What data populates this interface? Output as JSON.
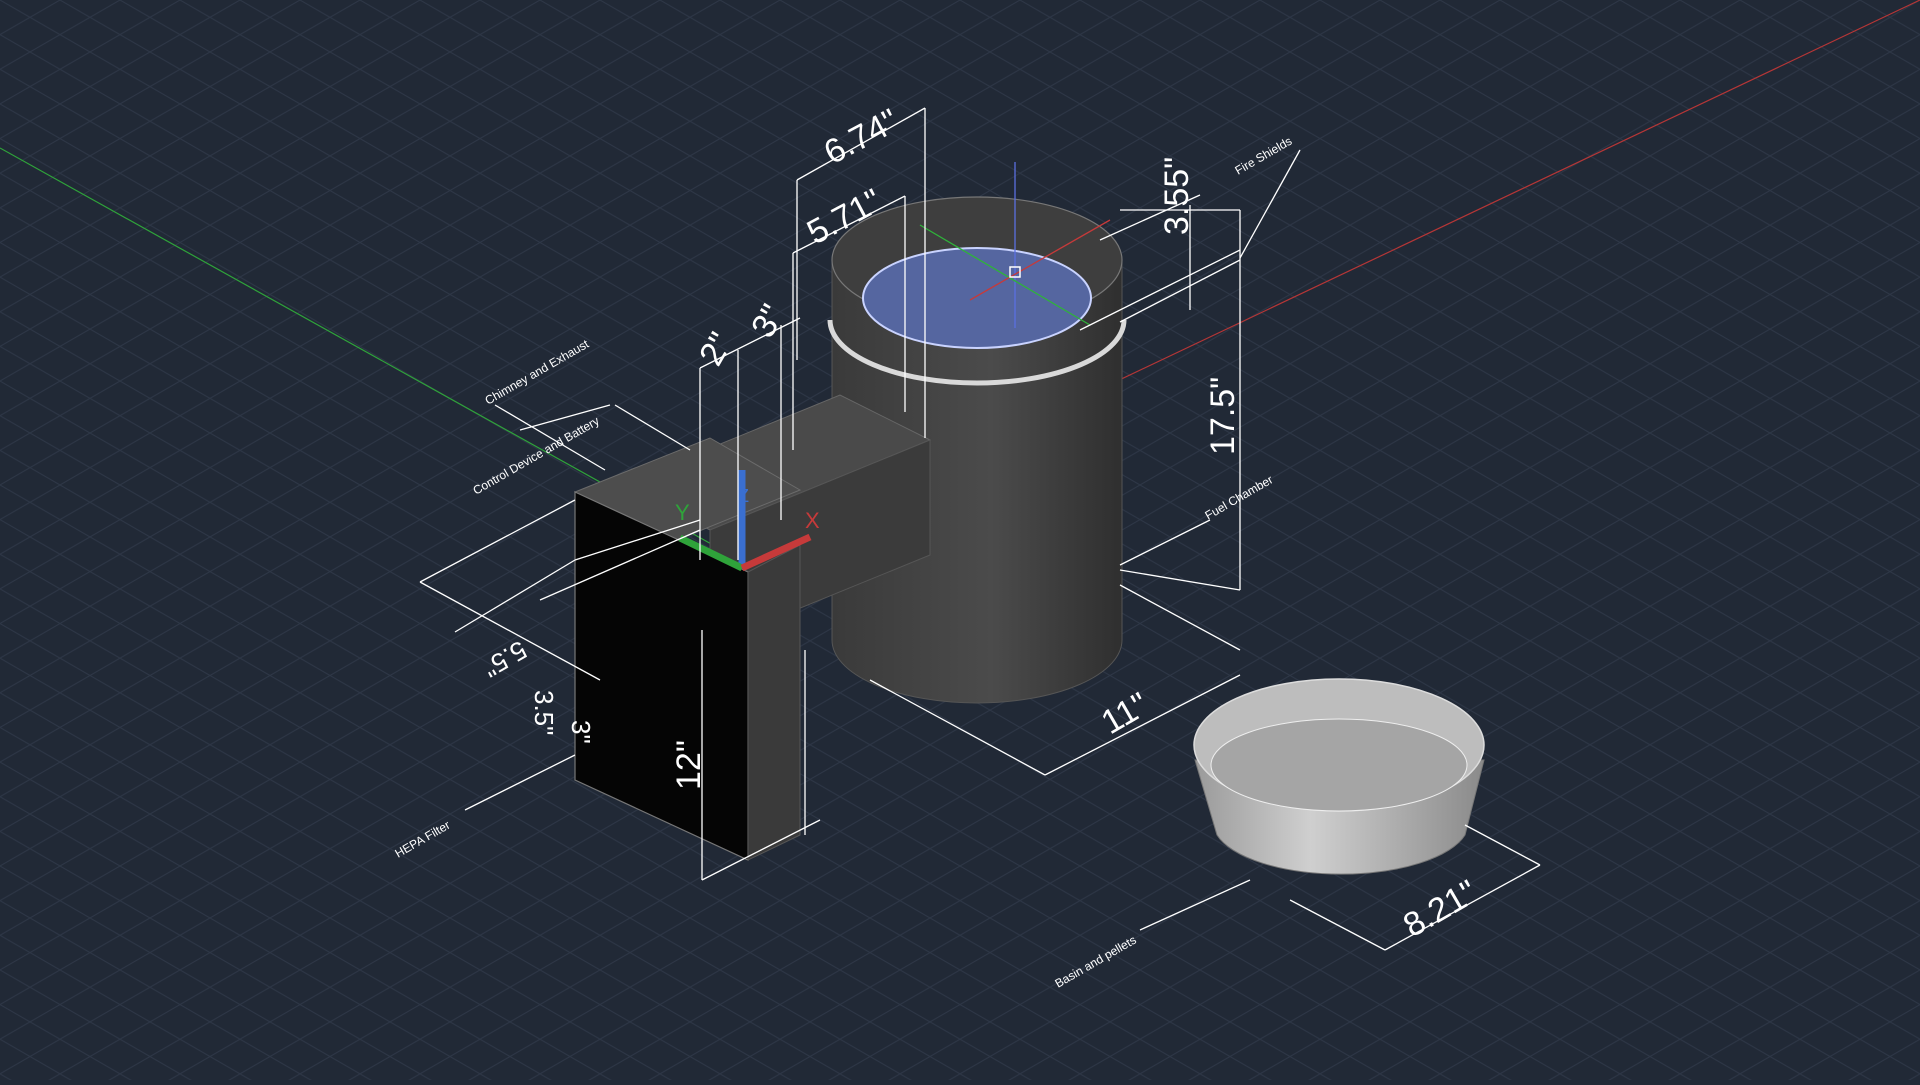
{
  "viewport": {
    "background": "#212936",
    "x_axis_color": "#c63a3a",
    "y_axis_color": "#2fa33a",
    "z_axis_color": "#3a6fd0"
  },
  "ucs": {
    "x_label": "X",
    "y_label": "Y",
    "z_label": "Z"
  },
  "dimensions": {
    "top_width_outer": "6.74\"",
    "top_width_inner": "5.71\"",
    "dim_2": "2\"",
    "dim_3": "3\"",
    "depth_3_55": "3.55\"",
    "height_17_5": "17.5\"",
    "base_11": "11\"",
    "filter_12": "12\"",
    "side_5_5": "5.5\"",
    "side_3_5": "3.5\"",
    "small_3": "3\"",
    "bowl_8_21": "8.21\""
  },
  "labels": {
    "chimney": "Chimney and Exhaust",
    "control": "Control Device and Battery",
    "fire_shields": "Fire Shields",
    "fuel_chamber": "Fuel Chamber",
    "hepa": "HEPA Filter",
    "bowl": "Basin and pellets"
  }
}
